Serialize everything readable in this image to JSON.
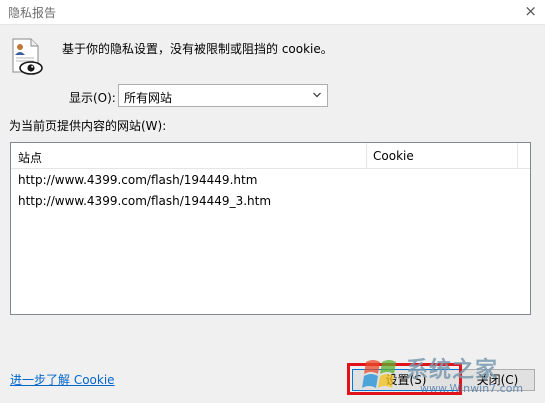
{
  "window": {
    "title": "隐私报告",
    "close_glyph": "×"
  },
  "summary": {
    "icon": "privacy-report-icon",
    "text": "基于你的隐私设置，没有被限制或阻挡的 cookie。"
  },
  "filter": {
    "label": "显示(O):",
    "selected": "所有网站",
    "icon": "chevron-down-icon"
  },
  "sites_list": {
    "label": "为当前页提供内容的网站(W):",
    "columns": [
      "站点",
      "Cookie"
    ],
    "rows": [
      {
        "site": "http://www.4399.com/flash/194449.htm",
        "cookie": ""
      },
      {
        "site": "http://www.4399.com/flash/194449_3.htm",
        "cookie": ""
      }
    ]
  },
  "footer": {
    "learn_more": "进一步了解 Cookie",
    "settings_button": "设置(S)",
    "close_button": "关闭(C)"
  },
  "watermark": {
    "brand": "系统之家",
    "url": "www.Winwin7.com"
  },
  "colors": {
    "link": "#0066cc",
    "highlight": "#e0151b",
    "focus_border": "#0078d7"
  }
}
